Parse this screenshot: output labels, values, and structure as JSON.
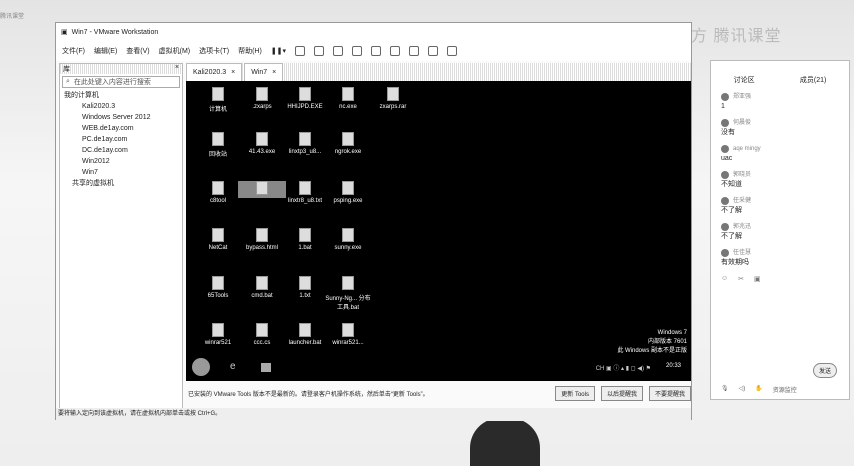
{
  "watermark": {
    "left": "腾讯课堂",
    "right": "安全官方 腾讯课堂"
  },
  "window": {
    "title": "Win7 - VMware Workstation",
    "menu": [
      "文件(F)",
      "编辑(E)",
      "查看(V)",
      "虚拟机(M)",
      "选项卡(T)",
      "帮助(H)"
    ]
  },
  "sidebar": {
    "title": "库",
    "search_placeholder": "在此处键入内容进行搜索",
    "root": "我的计算机",
    "vms": [
      "Kali2020.3",
      "Windows Server 2012",
      "WEB.de1ay.com",
      "PC.de1ay.com",
      "DC.de1ay.com",
      "Win2012",
      "Win7"
    ],
    "shared": "共享的虚拟机"
  },
  "tabs": [
    "Kali2020.3",
    "Win7"
  ],
  "desktop": [
    [
      "计算机",
      ".zxarps",
      "HHIJPD.EXE",
      "nc.exe",
      "zxarps.rar"
    ],
    [
      "回收站",
      "41.43.exe",
      "linxtp3_u8...",
      "ngrok.exe"
    ],
    [
      "c8tool",
      "",
      "linxtr8_u8.txt",
      "psping.exe"
    ],
    [
      "NetCat",
      "bypass.html",
      "1.bat",
      "sunny.exe"
    ],
    [
      "65Tools",
      "cmd.bat",
      "1.txt",
      "Sunny-Ng... 分布工具.bat"
    ],
    [
      "winrar521",
      "ccc.cs",
      "launcher.bat",
      "winrar521..."
    ]
  ],
  "wininfo": [
    "Windows 7",
    "内部版本 7601",
    "此 Windows 副本不是正版"
  ],
  "clock": "20:33",
  "notification": {
    "text": "已安装的 VMware Tools 版本不是最新的。请登录客户机操作系统，然后单击“更新 Tools”。",
    "buttons": [
      "更新 Tools",
      "以后提醒我",
      "不要提醒我"
    ]
  },
  "statusbar": "要将输入定向到该虚拟机，请在虚拟机内部单击或按 Ctrl+G。",
  "chat": {
    "tabs": [
      "讨论区",
      "成员(21)"
    ],
    "messages": [
      {
        "name": "郑亚强",
        "text": "1"
      },
      {
        "name": "何晨俊",
        "text": "没有"
      },
      {
        "name": "aqe mingy",
        "text": "uac"
      },
      {
        "name": "郭晓员",
        "text": "不知道"
      },
      {
        "name": "任采健",
        "text": "不了解"
      },
      {
        "name": "郭兆迅",
        "text": "不了解"
      },
      {
        "name": "任佳慧",
        "text": "有效期吗"
      }
    ],
    "send": "发送",
    "monitor": "资源监控"
  }
}
